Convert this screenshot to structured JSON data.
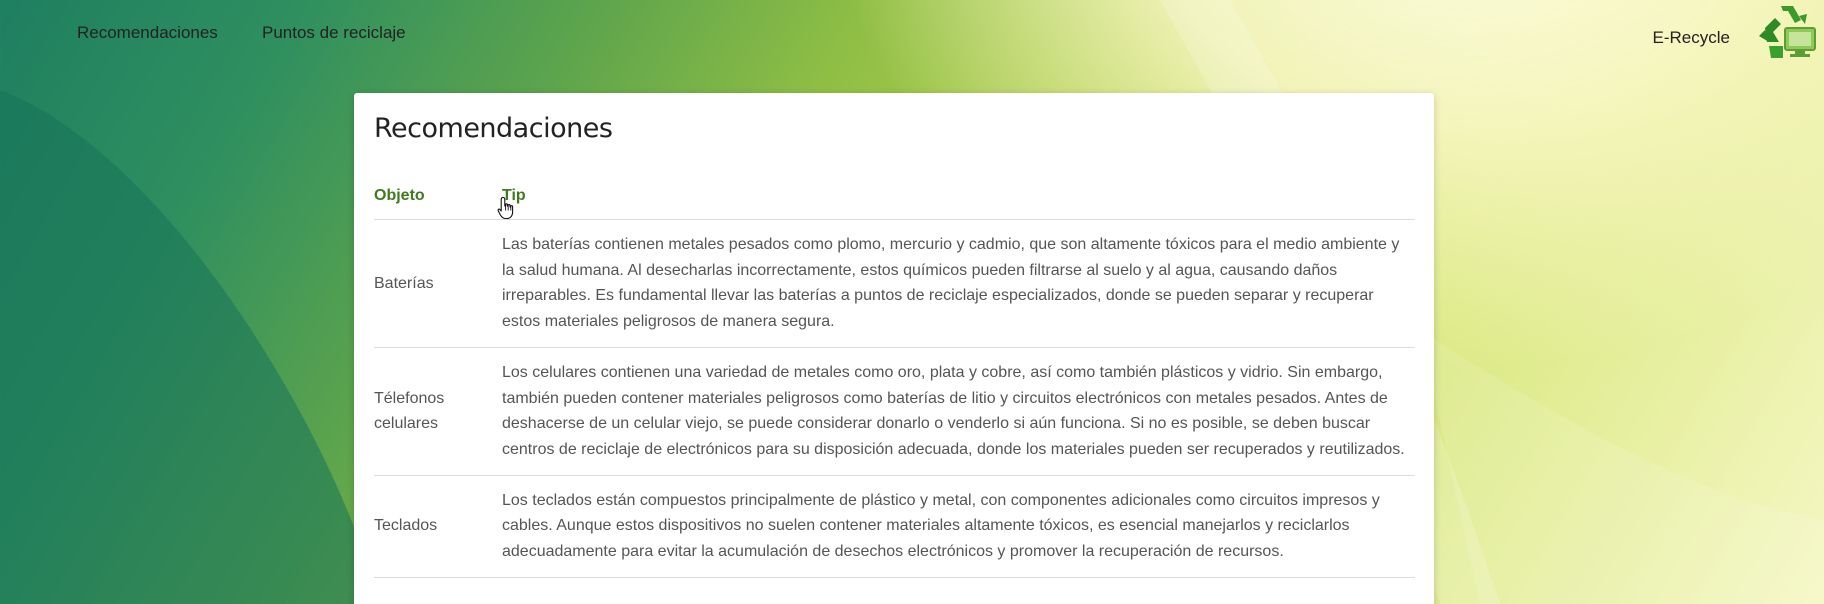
{
  "nav": {
    "items": [
      {
        "label": "Recomendaciones"
      },
      {
        "label": "Puntos de reciclaje"
      }
    ],
    "brand": "E-Recycle",
    "logo_icon": "recycle-computer-logo-icon"
  },
  "colors": {
    "accent": "#3f7a1c",
    "bg_dark": "#1e7f61",
    "bg_light": "#f5f7c4"
  },
  "card": {
    "title": "Recomendaciones",
    "table": {
      "headers": {
        "object": "Objeto",
        "tip": "Tip"
      },
      "rows": [
        {
          "object": "Baterías",
          "tip": "Las baterías contienen metales pesados como plomo, mercurio y cadmio, que son altamente tóxicos para el medio ambiente y la salud humana. Al desecharlas incorrectamente, estos químicos pueden filtrarse al suelo y al agua, causando daños irreparables. Es fundamental llevar las baterías a puntos de reciclaje especializados, donde se pueden separar y recuperar estos materiales peligrosos de manera segura."
        },
        {
          "object": "Télefonos celulares",
          "tip": "Los celulares contienen una variedad de metales como oro, plata y cobre, así como también plásticos y vidrio. Sin embargo, también pueden contener materiales peligrosos como baterías de litio y circuitos electrónicos con metales pesados. Antes de deshacerse de un celular viejo, se puede considerar donarlo o venderlo si aún funciona. Si no es posible, se deben buscar centros de reciclaje de electrónicos para su disposición adecuada, donde los materiales pueden ser recuperados y reutilizados."
        },
        {
          "object": "Teclados",
          "tip": "Los teclados están compuestos principalmente de plástico y metal, con componentes adicionales como circuitos impresos y cables. Aunque estos dispositivos no suelen contener materiales altamente tóxicos, es esencial manejarlos y reciclarlos adecuadamente para evitar la acumulación de desechos electrónicos y promover la recuperación de recursos."
        }
      ]
    }
  }
}
